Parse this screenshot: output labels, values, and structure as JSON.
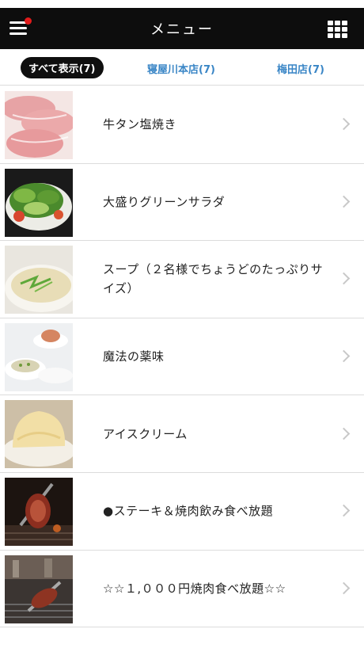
{
  "header": {
    "title": "メニュー",
    "menu_icon": "hamburger-icon",
    "notification_dot_color": "#e21b1b",
    "grid_icon": "grid-icon"
  },
  "tabs": [
    {
      "label": "すべて表示(7)",
      "active": true
    },
    {
      "label": "寝屋川本店(7)",
      "active": false
    },
    {
      "label": "梅田店(7)",
      "active": false
    }
  ],
  "menu_items": [
    {
      "name": "牛タン塩焼き",
      "image": "beef-tongue-photo"
    },
    {
      "name": "大盛りグリーンサラダ",
      "image": "green-salad-photo"
    },
    {
      "name": "スープ（２名様でちょうどのたっぷりサイズ）",
      "image": "soup-photo"
    },
    {
      "name": "魔法の薬味",
      "image": "condiments-photo"
    },
    {
      "name": "アイスクリーム",
      "image": "ice-cream-photo"
    },
    {
      "name": "●ステーキ＆焼肉飲み食べ放題",
      "image": "steak-grill-photo"
    },
    {
      "name": "☆☆１,０００円焼肉食べ放題☆☆",
      "image": "yakiniku-photo"
    }
  ],
  "colors": {
    "header_bg": "#0d0d0d",
    "tab_link": "#3a86c6",
    "active_tab_bg": "#0f0f0f"
  }
}
